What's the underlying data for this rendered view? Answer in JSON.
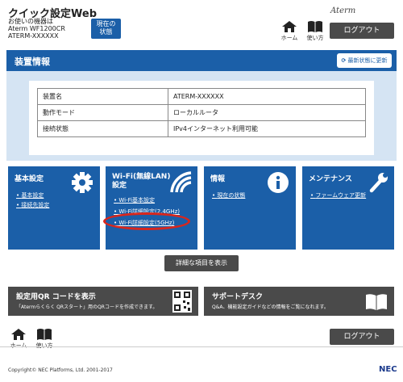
{
  "header": {
    "app_title": "クイック設定Web",
    "device_lines": [
      "お使いの機器は",
      "Aterm WF1200CR",
      "ATERM-XXXXXX"
    ],
    "status_button": [
      "現在の",
      "状態"
    ],
    "brand": "Aterm",
    "home_label": "ホーム",
    "manual_label": "使い方",
    "logout_label": "ログアウト"
  },
  "device_info": {
    "title": "装置情報",
    "refresh_label": "最新状態に更新",
    "rows": [
      {
        "label": "装置名",
        "value": "ATERM-XXXXXX"
      },
      {
        "label": "動作モード",
        "value": "ローカルルータ"
      },
      {
        "label": "接続状態",
        "value": "IPv4インターネット利用可能"
      }
    ]
  },
  "tiles": {
    "basic": {
      "title": "基本設定",
      "links": [
        "基本設定",
        "接続先設定"
      ]
    },
    "wifi": {
      "title": "Wi-Fi(無線LAN)設定",
      "links": [
        "Wi-Fi基本設定",
        "Wi-Fi詳細設定(2.4GHz)",
        "Wi-Fi詳細設定(5GHz)"
      ]
    },
    "info": {
      "title": "情報",
      "links": [
        "現在の状態"
      ]
    },
    "maintenance": {
      "title": "メンテナンス",
      "links": [
        "ファームウェア更新"
      ]
    }
  },
  "detail_button": "詳細な項目を表示",
  "qr_panel": {
    "title": "設定用QR コードを表示",
    "subtitle": "「Atermらくらく QRスタート」用のQRコードを作成できます。"
  },
  "support_panel": {
    "title": "サポートデスク",
    "subtitle": "Q&A、機能設定ガイドなどの情報をご覧になれます。"
  },
  "footer": {
    "home_label": "ホーム",
    "manual_label": "使い方",
    "logout_label": "ログアウト",
    "copyright": "Copyright© NEC Platforms, Ltd. 2001-2017",
    "company_logo": "NEC"
  },
  "colors": {
    "accent": "#1b5fa8",
    "panel_bg": "#d5e4f3",
    "dark_button": "#4a4a4a",
    "highlight_ring": "#d9261c"
  }
}
